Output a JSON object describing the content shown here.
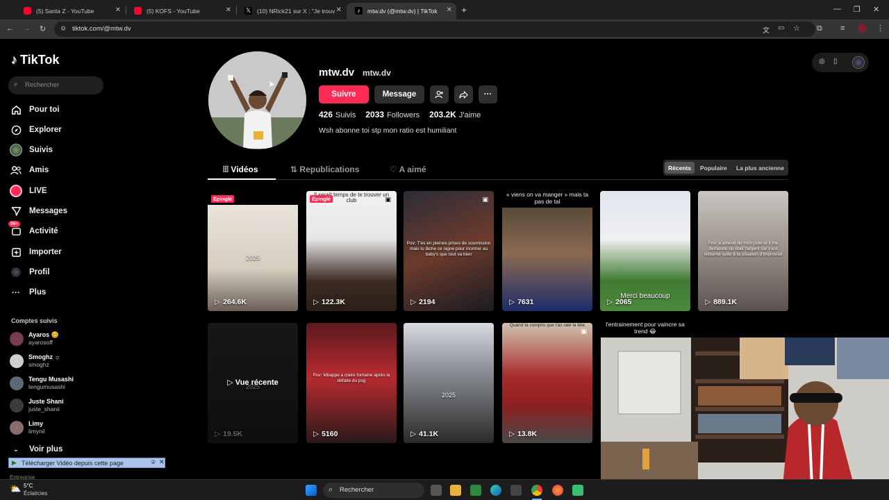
{
  "browser": {
    "tabs": [
      {
        "title": "(5) Santa Z - YouTube",
        "icon": "youtube-icon"
      },
      {
        "title": "(5) KOFS - YouTube",
        "icon": "youtube-icon"
      },
      {
        "title": "(10) NRick21 sur X : \"Je trouve ç",
        "icon": "x-icon"
      },
      {
        "title": "mtw.dv (@mtw.dv) | TikTok",
        "icon": "tiktok-icon"
      }
    ],
    "url": "tiktok.com/@mtw.dv"
  },
  "sidebar": {
    "logo": "TikTok",
    "search_placeholder": "Rechercher",
    "items": [
      {
        "label": "Pour toi",
        "icon": "home-icon"
      },
      {
        "label": "Explorer",
        "icon": "compass-icon"
      },
      {
        "label": "Suivis",
        "icon": "following-avatar-icon"
      },
      {
        "label": "Amis",
        "icon": "friends-icon"
      },
      {
        "label": "LIVE",
        "icon": "live-icon"
      },
      {
        "label": "Messages",
        "icon": "messages-icon"
      },
      {
        "label": "Activité",
        "icon": "activity-icon",
        "badge": "99+"
      },
      {
        "label": "Importer",
        "icon": "upload-icon"
      },
      {
        "label": "Profil",
        "icon": "profile-icon"
      },
      {
        "label": "Plus",
        "icon": "more-icon"
      }
    ],
    "following_title": "Comptes suivis",
    "accounts": [
      {
        "name": "Ayaros 🥴",
        "handle": "ayarosoff",
        "color": "#7a3b4f"
      },
      {
        "name": "Smoghz ☼",
        "handle": "smoghz",
        "color": "#cfcfcf"
      },
      {
        "name": "Tengu Musashi",
        "handle": "tengumusashi",
        "color": "#5b6a7a"
      },
      {
        "name": "Juste Shani",
        "handle": "juste_shanii",
        "color": "#3c3c3c"
      },
      {
        "name": "Limy",
        "handle": "limynil",
        "color": "#8a6a6a"
      }
    ],
    "see_more": "Voir plus",
    "section_cut": "Entreprise"
  },
  "profile": {
    "username": "mtw.dv",
    "nickname": "mtw.dv",
    "follow_label": "Suivre",
    "message_label": "Message",
    "following_count": "426",
    "following_label": "Suivis",
    "followers_count": "2033",
    "followers_label": "Followers",
    "likes_count": "203.2K",
    "likes_label": "J'aime",
    "bio": "Wsh abonne toi stp mon ratio est humiliant"
  },
  "tabs": {
    "videos": "Vidéos",
    "reposts": "Republications",
    "liked": "A aimé"
  },
  "sort": {
    "recent": "Récents",
    "popular": "Populaire",
    "oldest": "La plus ancienne"
  },
  "videos": [
    {
      "views": "264.6K",
      "pinned": "Épinglé",
      "caption": "2025",
      "bg": "linear-gradient(180deg,#e9e4dc 0%,#d7cdbf 60%,#6b5f58 100%)"
    },
    {
      "views": "122.3K",
      "pinned": "Épinglé",
      "caption": "Il serait temps de te trouver un club",
      "bg": "linear-gradient(180deg,#f2f2f2 0%,#e6e6e6 40%,#3b2b22 75%,#2a1e18 100%)"
    },
    {
      "views": "2194",
      "caption": "Pov: T'es en pleines prises de soumission mais tu lâche ce signe pour montrer au baby's que tout va bien",
      "bg": "linear-gradient(160deg,#2c2c38 0%,#6b3b2b 50%,#1b1b22 100%)"
    },
    {
      "views": "7631",
      "caption": "",
      "title": "« viens on va manger » mais ta pas de tal",
      "bg": "linear-gradient(180deg,#5a4a3a 0%,#8b6a52 45%,#1e2c6a 100%)"
    },
    {
      "views": "2065",
      "caption": "Merci beaucoup",
      "bg": "linear-gradient(180deg,#dfe6ee 0%,#f0f0f0 40%,#3f7a32 75%,#4d8a3b 100%)"
    },
    {
      "views": "889.1K",
      "caption": "Pov: à amené de mon pote et il me demande où était l'argent car il est retourné suite à ta situation d'improvisé",
      "bg": "linear-gradient(180deg,#c9c7c3 0%,#9a8f86 50%,#585250 100%)"
    },
    {
      "views": "19.5K",
      "caption": "2025",
      "recent": "Vue récente",
      "bg": "linear-gradient(180deg,#2a2a2a 0%,#1a1a1a 100%)"
    },
    {
      "views": "5160",
      "caption": "Pov: Mbappe a claire fontaine après la défaite du psg",
      "bg": "linear-gradient(180deg,#5a1a1f 0%,#b82a30 45%,#2a1a1a 100%)"
    },
    {
      "views": "41.1K",
      "caption": "2025",
      "bg": "linear-gradient(180deg,#d7dbe0 0%,#8a8e94 40%,#2a2a2a 100%)"
    },
    {
      "views": "13.8K",
      "caption": "Quand ta compris que t'as raté la tête",
      "bg": "linear-gradient(180deg,#cfc4b2 0%,#a82a2a 45%,#8a2020 70%,#4a4a4a 100%)"
    },
    {
      "views": "",
      "title": "l'entrainement pour vaincre sa trend 😂",
      "bg": "#000"
    }
  ],
  "download_bar": "Télécharger Vidéo depuis cette page",
  "taskbar": {
    "weather_temp": "5°C",
    "weather_desc": "Éclaircies",
    "search": "Rechercher"
  },
  "colors": {
    "accent": "#fe2c55",
    "bg": "#000000",
    "chrome": "#1f1f1f"
  }
}
